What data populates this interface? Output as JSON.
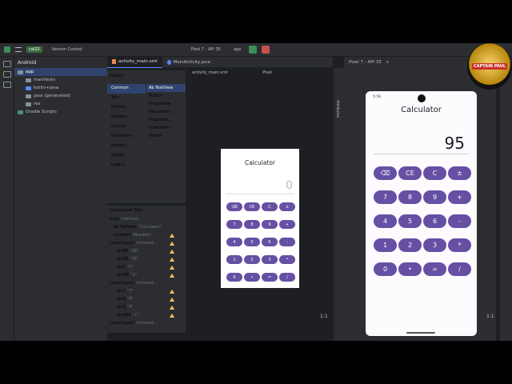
{
  "topbar": {
    "project": "cal22",
    "vcs": "Version Control",
    "device": "Pixel 7 - API 35",
    "run_config": "app"
  },
  "project_panel": {
    "view": "Android",
    "items": [
      {
        "label": "app",
        "level": 0
      },
      {
        "label": "manifests",
        "level": 1
      },
      {
        "label": "kotlin+java",
        "level": 1
      },
      {
        "label": "java (generated)",
        "level": 1
      },
      {
        "label": "res",
        "level": 1
      },
      {
        "label": "Gradle Scripts",
        "level": 0
      }
    ]
  },
  "editor_tabs": [
    {
      "label": "activity_main.xml",
      "active": true
    },
    {
      "label": "MainActivity.java",
      "active": false
    }
  ],
  "design_toolbar": {
    "file": "activity_main.xml",
    "device": "Pixel"
  },
  "palette": {
    "title": "Palette",
    "categories": [
      "Common",
      "Text",
      "Buttons",
      "Widgets",
      "Layouts",
      "Containers",
      "Helpers",
      "Google",
      "Legacy"
    ],
    "items": [
      "Ab TextView",
      "Button",
      "ImageView",
      "RecyclerVi...",
      "Fragment...",
      "ScrollView",
      "Switch"
    ]
  },
  "component_tree": {
    "title": "Component Tree",
    "rows": [
      {
        "label": "main",
        "hint": "(vertical)",
        "warn": false
      },
      {
        "label": "Ab TextView",
        "hint": "\"Calculator\"",
        "warn": false
      },
      {
        "label": "number1",
        "hint": "(Number)",
        "warn": true
      },
      {
        "label": "LinearLayout",
        "hint": "(horizont...",
        "warn": true
      },
      {
        "label": "btnBS",
        "hint": "\"⌫\"",
        "warn": true
      },
      {
        "label": "btnCE",
        "hint": "\"CE\"",
        "warn": true
      },
      {
        "label": "btnC",
        "hint": "\"C\"",
        "warn": true
      },
      {
        "label": "btnPM",
        "hint": "\"±\"",
        "warn": true
      },
      {
        "label": "LinearLayout",
        "hint": "(horizont...",
        "warn": false
      },
      {
        "label": "btn7",
        "hint": "\"7\"",
        "warn": true
      },
      {
        "label": "btn8",
        "hint": "\"8\"",
        "warn": true
      },
      {
        "label": "btn9",
        "hint": "\"9\"",
        "warn": true
      },
      {
        "label": "btnAdd",
        "hint": "\"+\"",
        "warn": true
      },
      {
        "label": "LinearLayout",
        "hint": "(horizont...",
        "warn": false
      }
    ]
  },
  "design_preview": {
    "title": "Calculator",
    "display": "0"
  },
  "running_device": {
    "tab": "Pixel 7 - API 35",
    "time": "5:56",
    "title": "Calculator",
    "display": "95"
  },
  "keypad": [
    [
      "⌫",
      "CE",
      "C",
      "±"
    ],
    [
      "7",
      "8",
      "9",
      "+"
    ],
    [
      "4",
      "5",
      "6",
      "-"
    ],
    [
      "1",
      "2",
      "3",
      "*"
    ],
    [
      "0",
      "•",
      "=",
      "/"
    ]
  ],
  "canvas_zoom": "1:1",
  "device_zoom": "1:1",
  "side_label": "Attributes",
  "overlay_badge": "CAPTAIN PAUL",
  "colors": {
    "ide_bg": "#1e1f22",
    "panel_bg": "#2b2d30",
    "calc_button": "#6650a4",
    "selection": "#2e436e"
  }
}
